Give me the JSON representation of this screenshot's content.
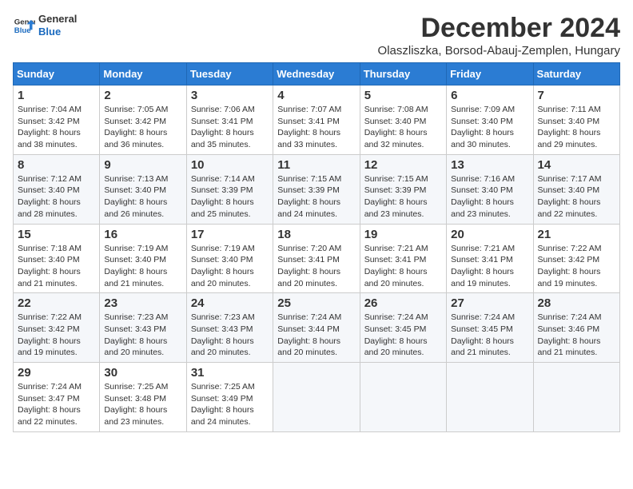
{
  "logo": {
    "text_general": "General",
    "text_blue": "Blue"
  },
  "title": "December 2024",
  "location": "Olaszliszka, Borsod-Abauj-Zemplen, Hungary",
  "days_of_week": [
    "Sunday",
    "Monday",
    "Tuesday",
    "Wednesday",
    "Thursday",
    "Friday",
    "Saturday"
  ],
  "weeks": [
    [
      {
        "day": "1",
        "sunrise": "7:04 AM",
        "sunset": "3:42 PM",
        "daylight": "8 hours and 38 minutes."
      },
      {
        "day": "2",
        "sunrise": "7:05 AM",
        "sunset": "3:42 PM",
        "daylight": "8 hours and 36 minutes."
      },
      {
        "day": "3",
        "sunrise": "7:06 AM",
        "sunset": "3:41 PM",
        "daylight": "8 hours and 35 minutes."
      },
      {
        "day": "4",
        "sunrise": "7:07 AM",
        "sunset": "3:41 PM",
        "daylight": "8 hours and 33 minutes."
      },
      {
        "day": "5",
        "sunrise": "7:08 AM",
        "sunset": "3:40 PM",
        "daylight": "8 hours and 32 minutes."
      },
      {
        "day": "6",
        "sunrise": "7:09 AM",
        "sunset": "3:40 PM",
        "daylight": "8 hours and 30 minutes."
      },
      {
        "day": "7",
        "sunrise": "7:11 AM",
        "sunset": "3:40 PM",
        "daylight": "8 hours and 29 minutes."
      }
    ],
    [
      {
        "day": "8",
        "sunrise": "7:12 AM",
        "sunset": "3:40 PM",
        "daylight": "8 hours and 28 minutes."
      },
      {
        "day": "9",
        "sunrise": "7:13 AM",
        "sunset": "3:40 PM",
        "daylight": "8 hours and 26 minutes."
      },
      {
        "day": "10",
        "sunrise": "7:14 AM",
        "sunset": "3:39 PM",
        "daylight": "8 hours and 25 minutes."
      },
      {
        "day": "11",
        "sunrise": "7:15 AM",
        "sunset": "3:39 PM",
        "daylight": "8 hours and 24 minutes."
      },
      {
        "day": "12",
        "sunrise": "7:15 AM",
        "sunset": "3:39 PM",
        "daylight": "8 hours and 23 minutes."
      },
      {
        "day": "13",
        "sunrise": "7:16 AM",
        "sunset": "3:40 PM",
        "daylight": "8 hours and 23 minutes."
      },
      {
        "day": "14",
        "sunrise": "7:17 AM",
        "sunset": "3:40 PM",
        "daylight": "8 hours and 22 minutes."
      }
    ],
    [
      {
        "day": "15",
        "sunrise": "7:18 AM",
        "sunset": "3:40 PM",
        "daylight": "8 hours and 21 minutes."
      },
      {
        "day": "16",
        "sunrise": "7:19 AM",
        "sunset": "3:40 PM",
        "daylight": "8 hours and 21 minutes."
      },
      {
        "day": "17",
        "sunrise": "7:19 AM",
        "sunset": "3:40 PM",
        "daylight": "8 hours and 20 minutes."
      },
      {
        "day": "18",
        "sunrise": "7:20 AM",
        "sunset": "3:41 PM",
        "daylight": "8 hours and 20 minutes."
      },
      {
        "day": "19",
        "sunrise": "7:21 AM",
        "sunset": "3:41 PM",
        "daylight": "8 hours and 20 minutes."
      },
      {
        "day": "20",
        "sunrise": "7:21 AM",
        "sunset": "3:41 PM",
        "daylight": "8 hours and 19 minutes."
      },
      {
        "day": "21",
        "sunrise": "7:22 AM",
        "sunset": "3:42 PM",
        "daylight": "8 hours and 19 minutes."
      }
    ],
    [
      {
        "day": "22",
        "sunrise": "7:22 AM",
        "sunset": "3:42 PM",
        "daylight": "8 hours and 19 minutes."
      },
      {
        "day": "23",
        "sunrise": "7:23 AM",
        "sunset": "3:43 PM",
        "daylight": "8 hours and 20 minutes."
      },
      {
        "day": "24",
        "sunrise": "7:23 AM",
        "sunset": "3:43 PM",
        "daylight": "8 hours and 20 minutes."
      },
      {
        "day": "25",
        "sunrise": "7:24 AM",
        "sunset": "3:44 PM",
        "daylight": "8 hours and 20 minutes."
      },
      {
        "day": "26",
        "sunrise": "7:24 AM",
        "sunset": "3:45 PM",
        "daylight": "8 hours and 20 minutes."
      },
      {
        "day": "27",
        "sunrise": "7:24 AM",
        "sunset": "3:45 PM",
        "daylight": "8 hours and 21 minutes."
      },
      {
        "day": "28",
        "sunrise": "7:24 AM",
        "sunset": "3:46 PM",
        "daylight": "8 hours and 21 minutes."
      }
    ],
    [
      {
        "day": "29",
        "sunrise": "7:24 AM",
        "sunset": "3:47 PM",
        "daylight": "8 hours and 22 minutes."
      },
      {
        "day": "30",
        "sunrise": "7:25 AM",
        "sunset": "3:48 PM",
        "daylight": "8 hours and 23 minutes."
      },
      {
        "day": "31",
        "sunrise": "7:25 AM",
        "sunset": "3:49 PM",
        "daylight": "8 hours and 24 minutes."
      },
      null,
      null,
      null,
      null
    ]
  ],
  "labels": {
    "sunrise": "Sunrise:",
    "sunset": "Sunset:",
    "daylight": "Daylight:"
  }
}
